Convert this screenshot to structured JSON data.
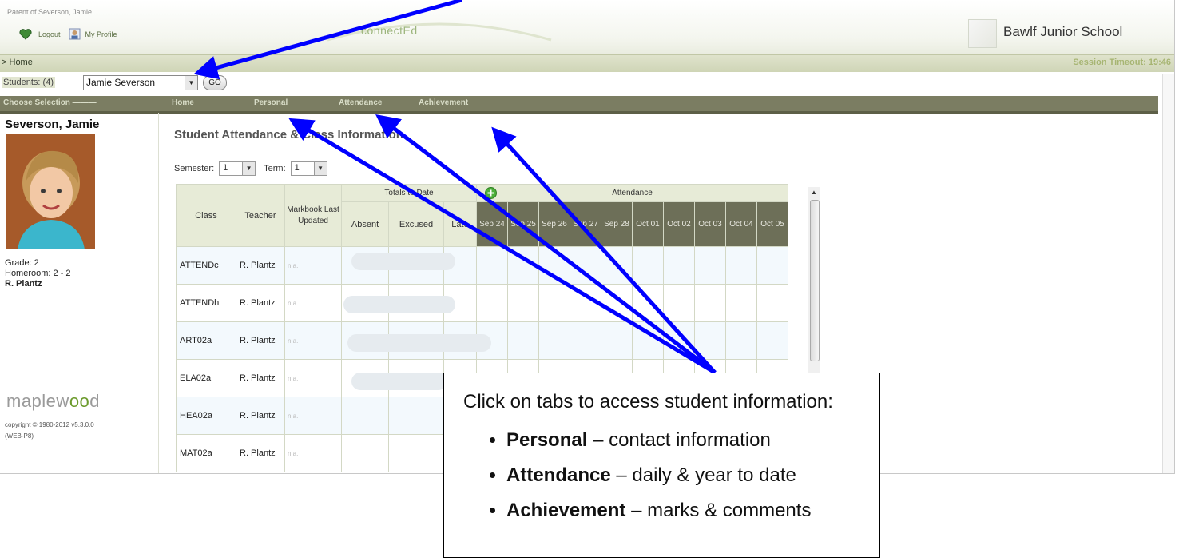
{
  "header": {
    "parent_of": "Parent of Severson, Jamie",
    "logout": "Logout",
    "my_profile": "My Profile",
    "logo_text": "connectEd",
    "school_name": "Bawlf Junior School"
  },
  "breadcrumb": {
    "home": "Home",
    "prefix": ">"
  },
  "session_timeout": "Session Timeout: 19:46",
  "students": {
    "label": "Students: (4)",
    "selected": "Jamie Severson",
    "go_label": "GO"
  },
  "nav": {
    "choose": "Choose Selection ———",
    "home": "Home",
    "personal": "Personal",
    "attendance": "Attendance",
    "achievement": "Achievement"
  },
  "student": {
    "name": "Severson, Jamie",
    "grade": "Grade: 2",
    "homeroom": "Homeroom: 2 - 2",
    "teacher": "R. Plantz"
  },
  "brand": {
    "copyright_line1": "copyright © 1980-2012 v5.3.0.0",
    "copyright_line2": "(WEB-P8)"
  },
  "main": {
    "title": "Student Attendance & Class Information",
    "semester_label": "Semester:",
    "semester_value": "1",
    "term_label": "Term:",
    "term_value": "1"
  },
  "table": {
    "headers": {
      "class": "Class",
      "teacher": "Teacher",
      "markbook": "Markbook Last Updated",
      "totals": "Totals to Date",
      "absent": "Absent",
      "excused": "Excused",
      "late": "Late",
      "attendance": "Attendance"
    },
    "dates": [
      "Sep 24",
      "Sep 25",
      "Sep 26",
      "Sep 27",
      "Sep 28",
      "Oct 01",
      "Oct 02",
      "Oct 03",
      "Oct 04",
      "Oct 05"
    ],
    "rows": [
      {
        "class": "ATTENDc",
        "teacher": "R. Plantz",
        "markbook": "n.a."
      },
      {
        "class": "ATTENDh",
        "teacher": "R. Plantz",
        "markbook": "n.a."
      },
      {
        "class": "ART02a",
        "teacher": "R. Plantz",
        "markbook": "n.a."
      },
      {
        "class": "ELA02a",
        "teacher": "R. Plantz",
        "markbook": "n.a."
      },
      {
        "class": "HEA02a",
        "teacher": "R. Plantz",
        "markbook": "n.a."
      },
      {
        "class": "MAT02a",
        "teacher": "R. Plantz",
        "markbook": "n.a."
      }
    ]
  },
  "callout": {
    "heading": "Click on tabs to access student information:",
    "items": [
      {
        "tab": "Personal",
        "desc": "– contact information"
      },
      {
        "tab": "Attendance",
        "desc": "– daily & year to date"
      },
      {
        "tab": "Achievement",
        "desc": "– marks & comments"
      }
    ]
  },
  "colors": {
    "nav_bar": "#7b7d62",
    "arrow": "#0000ff",
    "accent_green": "#6c9b2d"
  }
}
